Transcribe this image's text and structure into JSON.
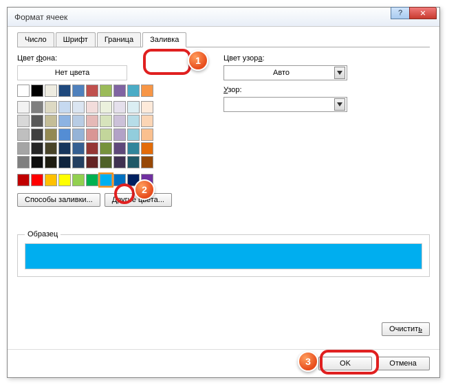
{
  "title": "Формат ячеек",
  "tabs": {
    "t0": "Число",
    "t1": "Шрифт",
    "t2": "Граница",
    "t3": "Заливка"
  },
  "left": {
    "bg_label": "Цвет фона:",
    "bg_underline": "ф",
    "nocolor": "Нет цвета",
    "fill_methods": "Способы заливки...",
    "other_colors": "Другие цвета..."
  },
  "right": {
    "pattern_color_label": "Цвет узора:",
    "pattern_color_underline": "а",
    "pattern_color_value": "Авто",
    "pattern_label": "Узор:",
    "pattern_underline": "У"
  },
  "sample_label": "Образец",
  "clear": "Очистить",
  "clear_underline": "ь",
  "ok": "OK",
  "cancel": "Отмена",
  "badges": {
    "b1": "1",
    "b2": "2",
    "b3": "3"
  },
  "selected_color": "#00aeef",
  "palette_top": [
    "#ffffff",
    "#000000",
    "#eeece1",
    "#1f497d",
    "#4f81bd",
    "#c0504d",
    "#9bbb59",
    "#8064a2",
    "#4bacc6",
    "#f79646"
  ],
  "palette_theme": [
    "#f2f2f2",
    "#7f7f7f",
    "#ddd9c3",
    "#c6d9f0",
    "#dbe5f1",
    "#f2dcdb",
    "#ebf1dd",
    "#e5e0ec",
    "#dbeef3",
    "#fdeada",
    "#d8d8d8",
    "#595959",
    "#c4bd97",
    "#8db3e2",
    "#b8cce4",
    "#e5b9b7",
    "#d7e3bc",
    "#ccc1d9",
    "#b7dde8",
    "#fbd5b5",
    "#bfbfbf",
    "#3f3f3f",
    "#938953",
    "#548dd4",
    "#95b3d7",
    "#d99694",
    "#c3d69b",
    "#b2a2c7",
    "#92cddc",
    "#fac08f",
    "#a5a5a5",
    "#262626",
    "#494429",
    "#17365d",
    "#366092",
    "#953734",
    "#76923c",
    "#5f497a",
    "#31859b",
    "#e36c09",
    "#7f7f7f",
    "#0c0c0c",
    "#1d1b10",
    "#0f243e",
    "#244061",
    "#632423",
    "#4f6128",
    "#3f3151",
    "#205867",
    "#974806"
  ],
  "palette_std": [
    "#c00000",
    "#ff0000",
    "#ffc000",
    "#ffff00",
    "#92d050",
    "#00b050",
    "#00b0f0",
    "#0070c0",
    "#002060",
    "#7030a0"
  ]
}
